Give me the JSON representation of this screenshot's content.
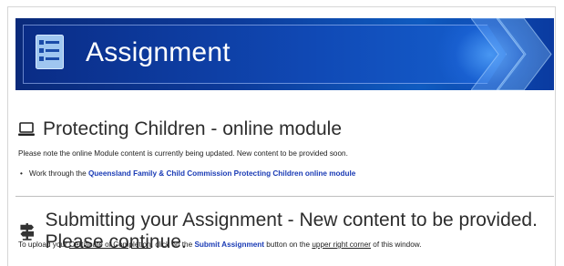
{
  "banner": {
    "title": "Assignment",
    "icon": "list-document-icon"
  },
  "section1": {
    "icon": "laptop-icon",
    "heading": "Protecting Children - online module",
    "note": "Please note the online Module content is currently being updated. New content to be provided soon.",
    "bullet_prefix": "Work through the ",
    "bullet_link": "Queensland Family & Child Commission Protecting Children online module"
  },
  "section2": {
    "icon": "signpost-icon",
    "heading": "Submitting your Assignment - New content to be provided. Please continue.",
    "instr_1": "To upload your ",
    "instr_cert": "Certificate of Completion",
    "instr_2": ", click on the ",
    "instr_submit": "Submit Assignment",
    "instr_3": " button on the ",
    "instr_corner": "upper right corner",
    "instr_4": " of this window."
  },
  "colors": {
    "banner_dark": "#0a2a7a",
    "banner_light": "#1560cf",
    "link": "#1a3bb5"
  }
}
